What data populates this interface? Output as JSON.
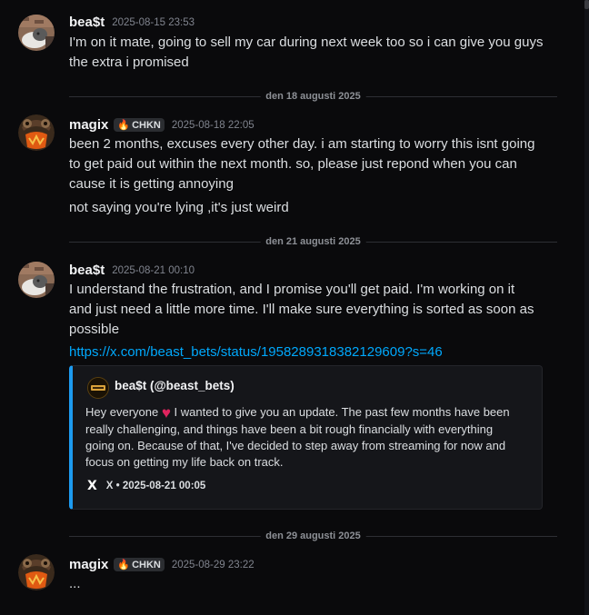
{
  "messages": [
    {
      "author": "bea$t",
      "timestamp": "2025-08-15 23:53",
      "lines": [
        "I'm on it mate, going to sell my car during next week too so i can give you guys",
        "the extra i promised"
      ]
    },
    {
      "author": "magix",
      "tag": "CHKN",
      "timestamp": "2025-08-18 22:05",
      "lines": [
        "been 2 months, excuses every other day. i am starting to worry this isnt going",
        "to get paid out within the next month. so, please just repond when you can",
        "cause it is getting annoying",
        "not saying you're lying ,it's just weird"
      ]
    },
    {
      "author": "bea$t",
      "timestamp": "2025-08-21 00:10",
      "lines": [
        "I understand the frustration, and I promise you'll get paid. I'm working on it",
        "and just need a little more time. I'll make sure everything is sorted as soon as",
        "possible"
      ],
      "link": "https://x.com/beast_bets/status/1958289318382129609?s=46"
    },
    {
      "author": "magix",
      "tag": "CHKN",
      "timestamp": "2025-08-29 23:22",
      "lines": [
        "..."
      ]
    }
  ],
  "dividers": [
    "den 18 augusti 2025",
    "den 21 augusti 2025",
    "den 29 augusti 2025"
  ],
  "embed": {
    "author": "bea$t (@beast_bets)",
    "body_before_heart": "Hey everyone",
    "heart": "♥",
    "body_lines": [
      " I wanted to give you an update. The past few months have been",
      "really challenging, and things have been a bit rough financially with everything",
      "going on. Because of that, I've decided to step away from streaming for now and",
      "focus on getting my life back on track."
    ],
    "footer": "X • 2025-08-21 00:05",
    "x_logo": "X",
    "accent": "#1d9bf0"
  },
  "icons": {
    "tag": "fire-icon",
    "embed_footer": "x-logo-icon"
  },
  "colors": {
    "background": "#0a0a0c",
    "link": "#00a8fc",
    "embed_border": "#1d9bf0"
  }
}
